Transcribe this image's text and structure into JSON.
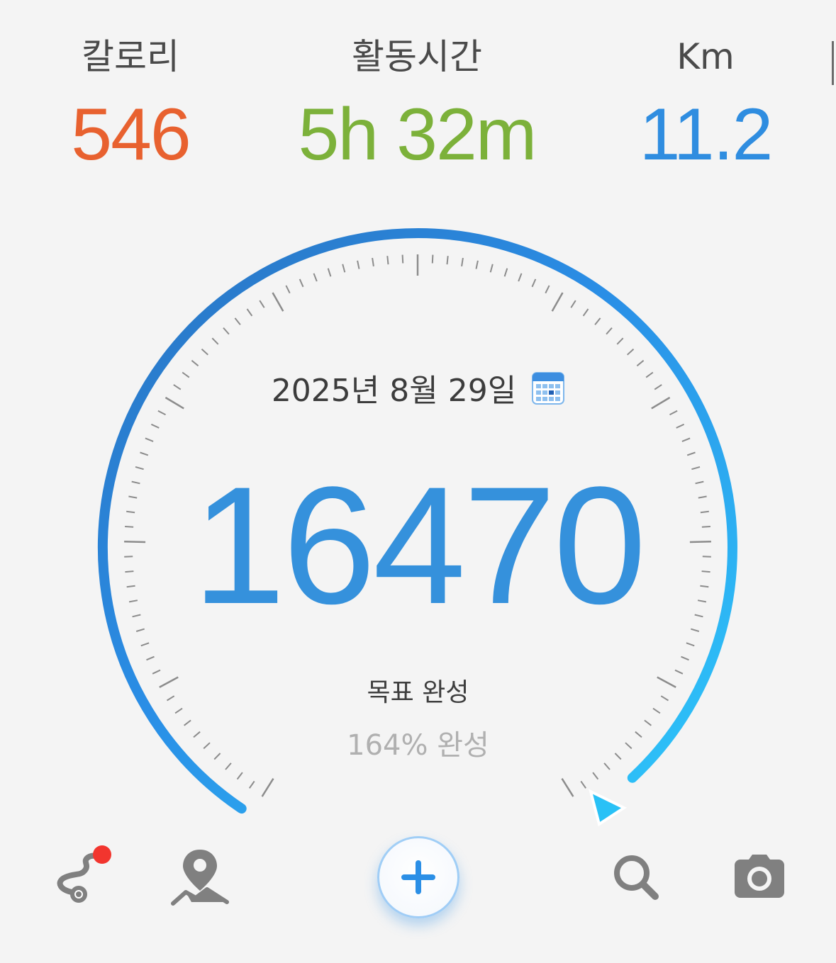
{
  "stats": {
    "calories": {
      "label": "칼로리",
      "value": "546",
      "color": "#e8612f"
    },
    "active_time": {
      "label": "활동시간",
      "value": "5h 32m",
      "color": "#7cb13a"
    },
    "distance": {
      "label": "Km",
      "value": "11.2",
      "color": "#2f8de0"
    }
  },
  "gauge": {
    "date": "2025년 8월 29일",
    "steps": "16470",
    "goal_status": "목표 완성",
    "goal_percent_text": "164% 완성",
    "goal_percent": 164,
    "accent_color": "#2b8fe6"
  },
  "bottom_nav": {
    "icons": [
      "route-icon",
      "map-pin-icon",
      "add-icon",
      "search-icon",
      "camera-icon"
    ],
    "notification_color": "#f2352e"
  }
}
